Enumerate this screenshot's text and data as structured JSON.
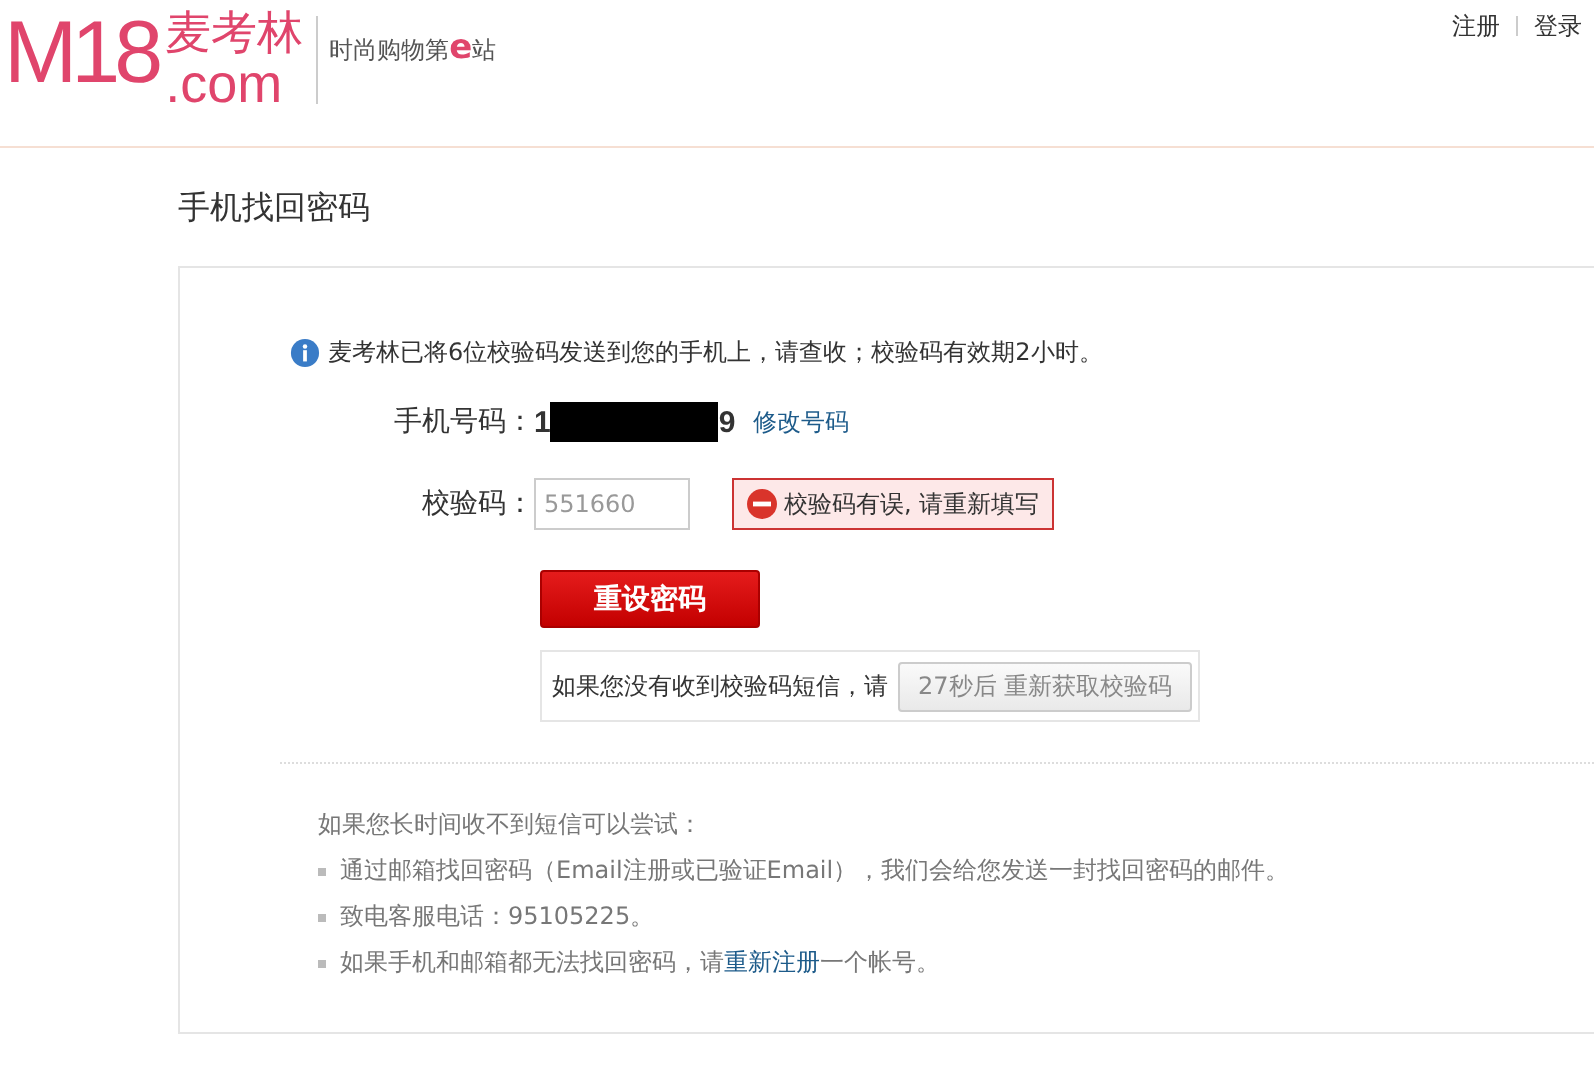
{
  "header": {
    "logo_brand": "M18",
    "logo_domain": ".com",
    "logo_name": "麦考林",
    "slogan_before": "时尚购物第",
    "slogan_mark": "e",
    "slogan_after": "站",
    "links": [
      "注册",
      "登录"
    ]
  },
  "page_title": "手机找回密码",
  "notice": "麦考林已将6位校验码发送到您的手机上，请查收；校验码有效期2小时。",
  "phone": {
    "label": "手机号码：",
    "prefix": "1",
    "suffix": "9",
    "redacted": true,
    "change_link": "修改号码"
  },
  "code": {
    "label": "校验码：",
    "value": "551660",
    "error": "校验码有误, 请重新填写"
  },
  "submit_button": "重设密码",
  "resend": {
    "prompt": "如果您没有收到校验码短信，请",
    "button": "27秒后 重新获取校验码",
    "disabled": true
  },
  "tips": {
    "heading": "如果您长时间收不到短信可以尝试：",
    "items": [
      {
        "text": "通过邮箱找回密码（Email注册或已验证Email），我们会给您发送一封找回密码的邮件。"
      },
      {
        "text": "致电客服电话：95105225。"
      },
      {
        "text": "如果手机和邮箱都无法找回密码，请",
        "link": "重新注册",
        "after": "一个帐号。"
      }
    ]
  }
}
